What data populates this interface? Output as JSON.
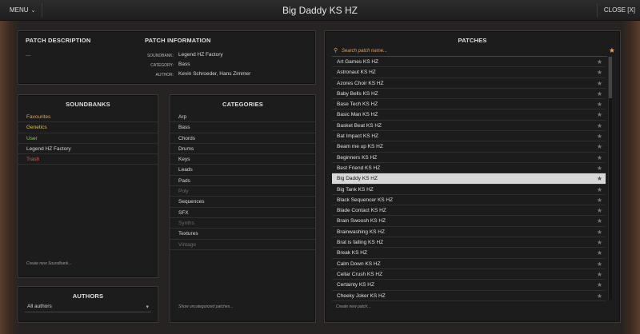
{
  "window": {
    "menu_label": "MENU",
    "title": "Big Daddy KS HZ",
    "close_label": "CLOSE [X]"
  },
  "description": {
    "title": "PATCH DESCRIPTION",
    "text": "—"
  },
  "info": {
    "title": "PATCH INFORMATION",
    "soundbank_label": "SOUNDBANK:",
    "soundbank": "Legend HZ Factory",
    "category_label": "CATEGORY:",
    "category": "Bass",
    "author_label": "AUTHOR:",
    "author": "Kevin Schroeder, Hans Zimmer"
  },
  "soundbanks": {
    "title": "SOUNDBANKS",
    "items": [
      {
        "label": "Favourites",
        "color": "#e0a060"
      },
      {
        "label": "Genetics",
        "color": "#d4c04a"
      },
      {
        "label": "User",
        "color": "#8ec86a"
      },
      {
        "label": "Legend HZ Factory",
        "color": "#d8d8d8"
      },
      {
        "label": "Trash",
        "color": "#e05555"
      }
    ],
    "create_link": "Create new Soundbank..."
  },
  "authors": {
    "title": "AUTHORS",
    "selected": "All authors"
  },
  "categories": {
    "title": "CATEGORIES",
    "items": [
      {
        "label": "Arp",
        "dim": false
      },
      {
        "label": "Bass",
        "dim": false
      },
      {
        "label": "Chords",
        "dim": false
      },
      {
        "label": "Drums",
        "dim": false
      },
      {
        "label": "Keys",
        "dim": false
      },
      {
        "label": "Leads",
        "dim": false
      },
      {
        "label": "Pads",
        "dim": false
      },
      {
        "label": "Poly",
        "dim": true
      },
      {
        "label": "Sequences",
        "dim": false
      },
      {
        "label": "SFX",
        "dim": false
      },
      {
        "label": "Synths",
        "dim": true
      },
      {
        "label": "Textures",
        "dim": false
      },
      {
        "label": "Vintage",
        "dim": true
      }
    ],
    "uncategorized_link": "Show uncategorized patches..."
  },
  "patches": {
    "title": "PATCHES",
    "search_placeholder": "Search patch name...",
    "selected_index": 11,
    "items": [
      "Art Games KS HZ",
      "Astronaut KS HZ",
      "Azores Choir KS HZ",
      "Baby Bells KS HZ",
      "Base Tech KS HZ",
      "Basic Man KS HZ",
      "Basket Beat KS HZ",
      "Bat Impact KS HZ",
      "Beam me up KS HZ",
      "Beginners KS HZ",
      "Best Friend KS HZ",
      "Big Daddy KS HZ",
      "Big Tank KS HZ",
      "Black Sequencer KS HZ",
      "Blade Contact KS HZ",
      "Brain Swoosh KS HZ",
      "Brainwashing KS HZ",
      "Brat is falling KS HZ",
      "Break KS HZ",
      "Calm Down KS HZ",
      "Cellar Crush KS HZ",
      "Certainty KS HZ",
      "Cheeky Joker KS HZ"
    ],
    "create_link": "Create new patch...",
    "accent": "#e0a060"
  }
}
